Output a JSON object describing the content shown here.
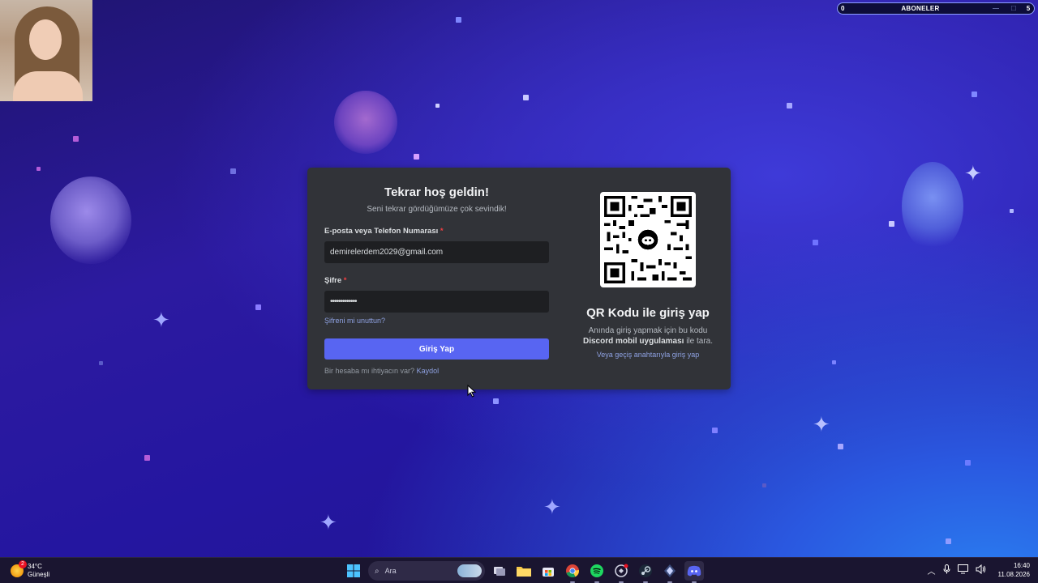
{
  "overlay": {
    "subscribers": {
      "left_count": "0",
      "title": "ABONELER",
      "right_count": "5"
    }
  },
  "login": {
    "title": "Tekrar hoş geldin!",
    "subtitle": "Seni tekrar gördüğümüze çok sevindik!",
    "email_label": "E-posta veya Telefon Numarası",
    "email_value": "demirelerdem2029@gmail.com",
    "password_label": "Şifre",
    "password_value": "•••••••••••••",
    "required_mark": "*",
    "forgot_link": "Şifreni mi unuttun?",
    "submit_label": "Giriş Yap",
    "register_prompt": "Bir hesaba mı ihtiyacın var?",
    "register_link": "Kaydol"
  },
  "qr": {
    "title": "QR Kodu ile giriş yap",
    "desc_before": "Anında giriş yapmak için bu kodu",
    "desc_bold": "Discord mobil uygulaması",
    "desc_after": " ile tara.",
    "passkey_link": "Veya geçiş anahtarıyla giriş yap"
  },
  "taskbar": {
    "weather_temp": "34°C",
    "weather_desc": "Güneşli",
    "weather_badge": "2",
    "search_placeholder": "Ara",
    "time": "16:40",
    "date": "11.08.2026",
    "pinned_icons": [
      "windows-start-icon",
      "task-view-icon",
      "file-explorer-icon",
      "microsoft-store-icon",
      "chrome-icon",
      "spotify-icon",
      "cheat-engine-icon",
      "steam-icon",
      "steam-tools-icon",
      "discord-icon"
    ],
    "tray_icons": [
      "chevron-up-icon",
      "microphone-icon",
      "display-icon",
      "speaker-icon"
    ]
  },
  "colors": {
    "card_bg": "#313338",
    "input_bg": "#1e1f22",
    "primary": "#5865f2",
    "link": "#8ea1e1",
    "required": "#f23f42"
  }
}
